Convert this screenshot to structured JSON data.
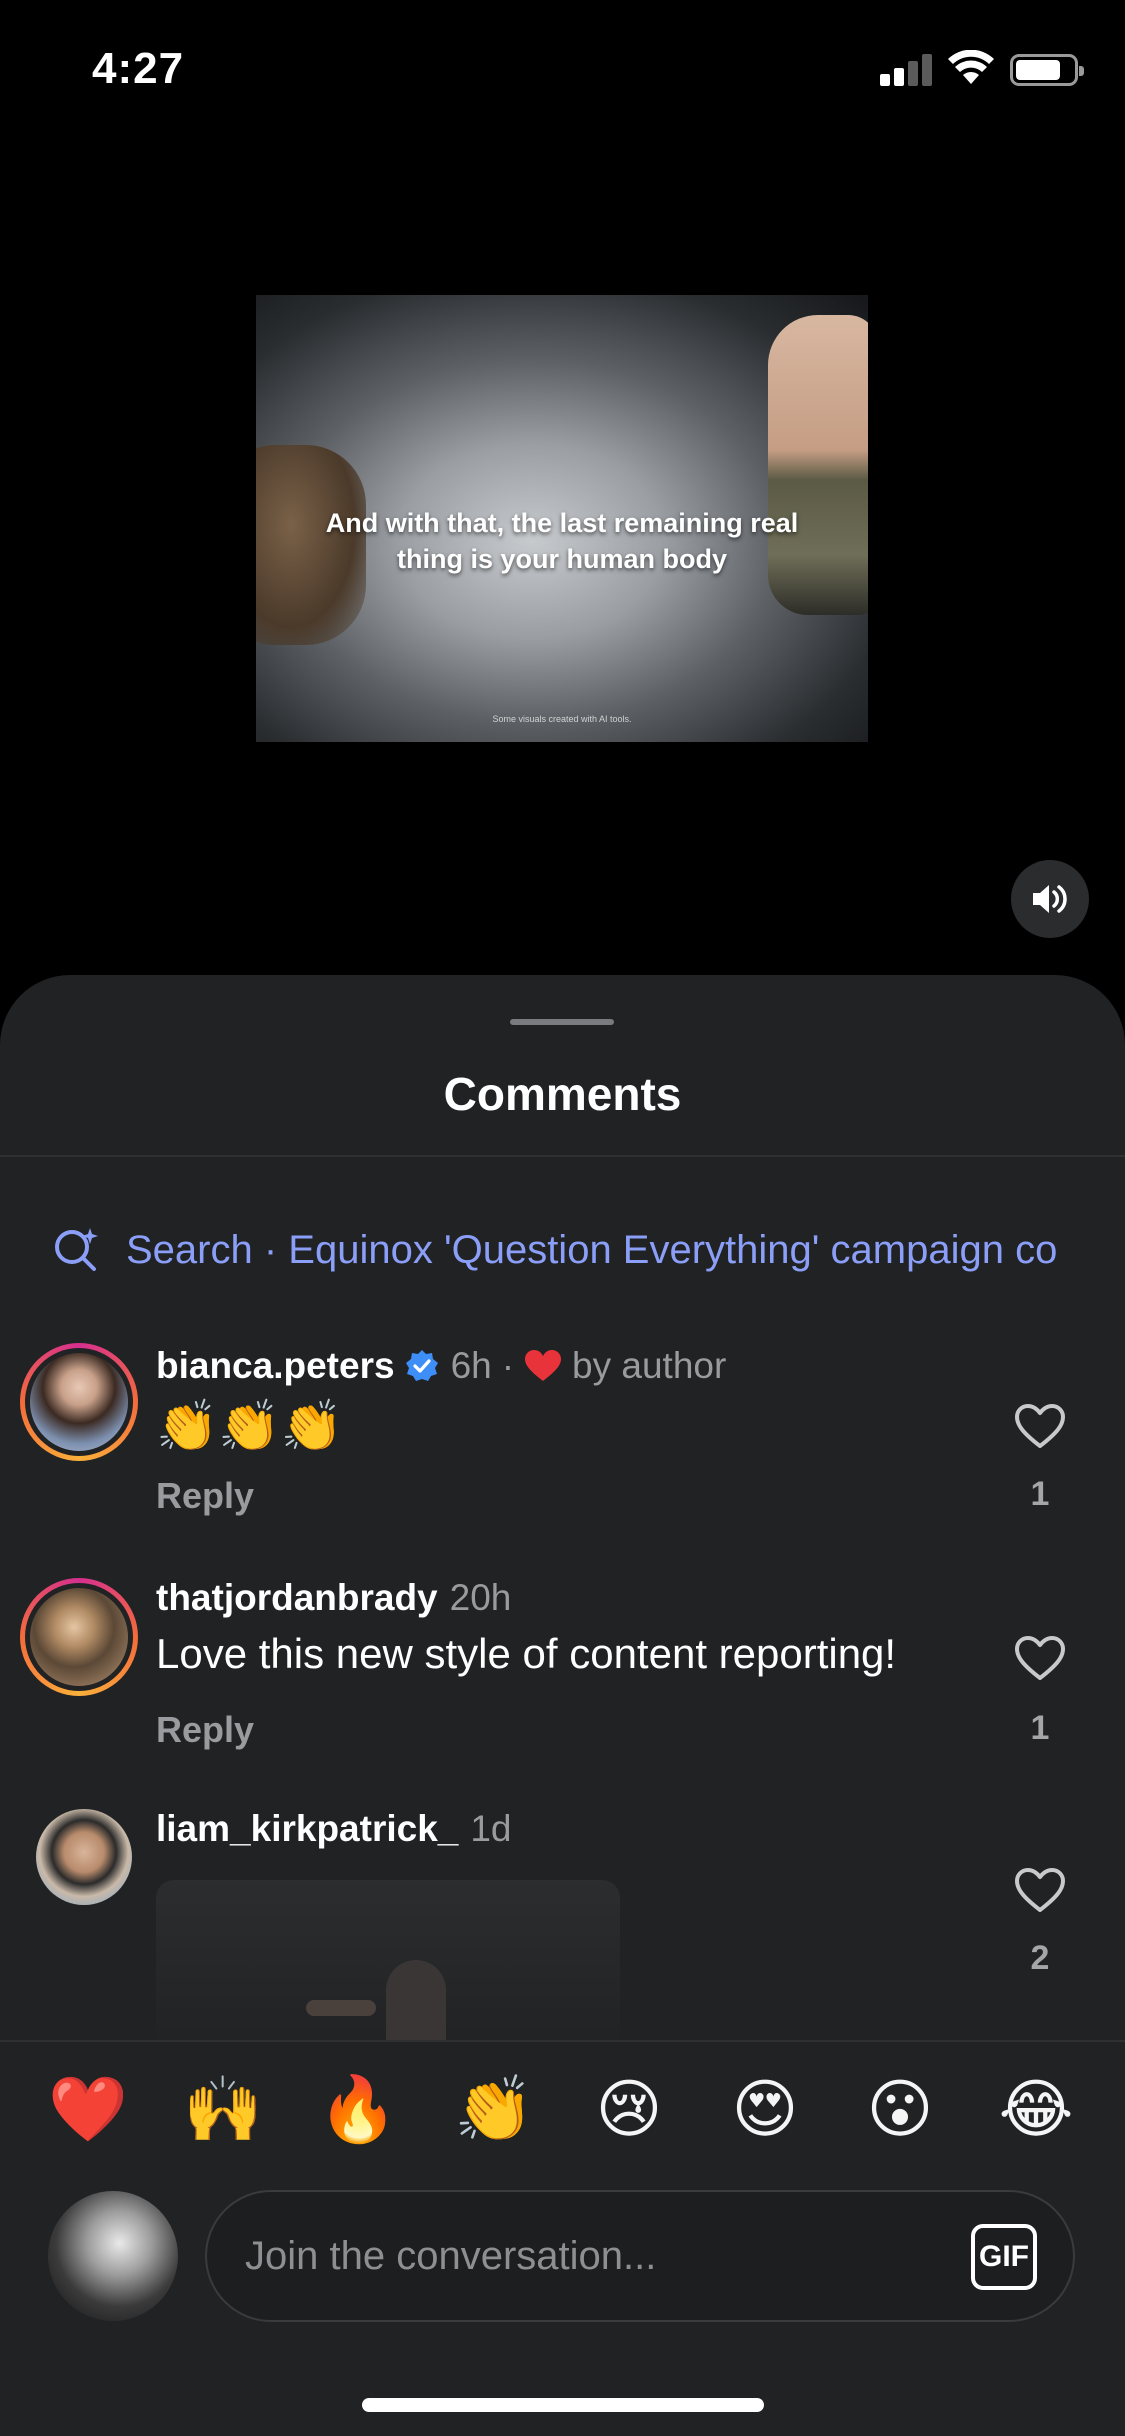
{
  "status_bar": {
    "time": "4:27"
  },
  "video": {
    "caption": "And with that, the last remaining real thing is your human body",
    "disclaimer": "Some visuals created with AI tools."
  },
  "sheet": {
    "title": "Comments",
    "search": "Search · Equinox 'Question Everything' campaign co"
  },
  "comments": [
    {
      "username": "bianca.peters",
      "verified": true,
      "time": "6h",
      "liked_by_author": "by author",
      "text": "👏👏👏",
      "reply": "Reply",
      "likes": "1"
    },
    {
      "username": "thatjordanbrady",
      "time": "20h",
      "text": "Love this new style of content reporting!",
      "reply": "Reply",
      "likes": "1"
    },
    {
      "username": "liam_kirkpatrick_",
      "time": "1d",
      "likes": "2"
    }
  ],
  "emoji_reactions": [
    "❤️",
    "🙌",
    "🔥",
    "👏",
    "😢",
    "😍",
    "😮",
    "😂"
  ],
  "composer": {
    "placeholder": "Join the conversation...",
    "gif_label": "GIF"
  },
  "colors": {
    "accent_search": "#8b9ff8",
    "verified": "#3e8ef7",
    "heart": "#e8333b",
    "sheet_bg": "#212224"
  }
}
